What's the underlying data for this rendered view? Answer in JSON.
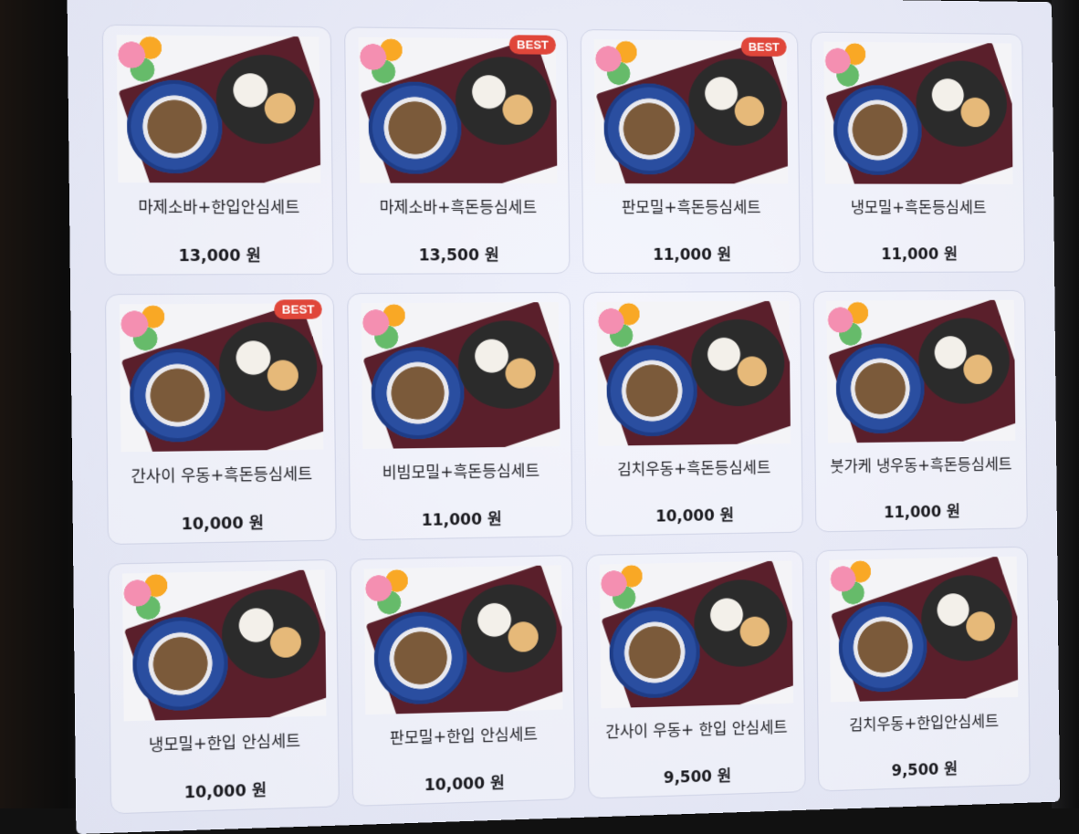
{
  "menu": {
    "items": [
      {
        "name": "마제소바+한입안심세트",
        "price": "13,000 원",
        "badge": ""
      },
      {
        "name": "마제소바+흑돈등심세트",
        "price": "13,500 원",
        "badge": "BEST"
      },
      {
        "name": "판모밀+흑돈등심세트",
        "price": "11,000 원",
        "badge": "BEST"
      },
      {
        "name": "냉모밀+흑돈등심세트",
        "price": "11,000 원",
        "badge": ""
      },
      {
        "name": "간사이 우동+흑돈등심세트",
        "price": "10,000 원",
        "badge": "BEST"
      },
      {
        "name": "비빔모밀+흑돈등심세트",
        "price": "11,000 원",
        "badge": ""
      },
      {
        "name": "김치우동+흑돈등심세트",
        "price": "10,000 원",
        "badge": ""
      },
      {
        "name": "붓가케 냉우동+흑돈등심세트",
        "price": "11,000 원",
        "badge": ""
      },
      {
        "name": "냉모밀+한입 안심세트",
        "price": "10,000 원",
        "badge": ""
      },
      {
        "name": "판모밀+한입 안심세트",
        "price": "10,000 원",
        "badge": ""
      },
      {
        "name": "간사이 우동+ 한입 안심세트",
        "price": "9,500 원",
        "badge": ""
      },
      {
        "name": "김치우동+한입안심세트",
        "price": "9,500 원",
        "badge": ""
      }
    ]
  },
  "colors": {
    "badge": "#e0463a",
    "screen": "#e7e9f6",
    "card_border": "#cfd3e6"
  }
}
